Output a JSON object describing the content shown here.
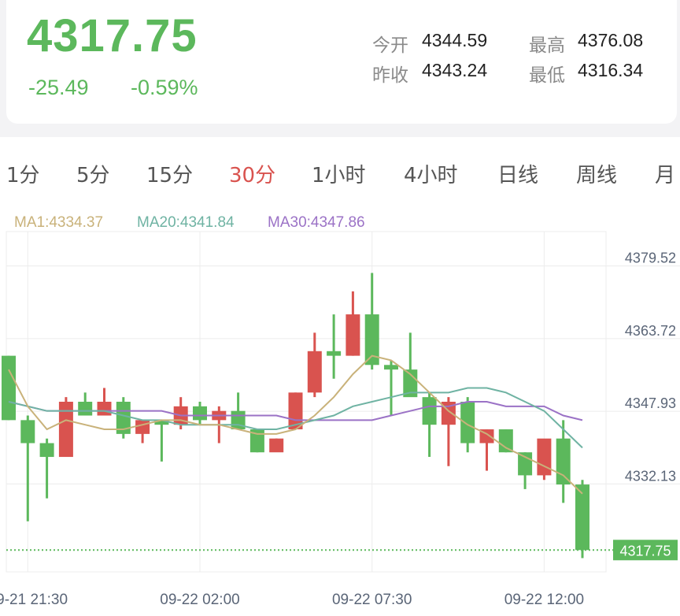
{
  "quote": {
    "price": "4317.75",
    "change_abs": "-25.49",
    "change_pct": "-0.59%",
    "stats": [
      {
        "label": "今开",
        "value": "4344.59"
      },
      {
        "label": "最高",
        "value": "4376.08"
      },
      {
        "label": "昨收",
        "value": "4343.24"
      },
      {
        "label": "最低",
        "value": "4316.34"
      }
    ]
  },
  "tabs": [
    {
      "label": "1分",
      "active": false
    },
    {
      "label": "5分",
      "active": false
    },
    {
      "label": "15分",
      "active": false
    },
    {
      "label": "30分",
      "active": true
    },
    {
      "label": "1小时",
      "active": false
    },
    {
      "label": "4小时",
      "active": false
    },
    {
      "label": "日线",
      "active": false
    },
    {
      "label": "周线",
      "active": false
    },
    {
      "label": "月",
      "active": false
    }
  ],
  "colors": {
    "up": "#d9534f",
    "down": "#5cb85c",
    "ma1": "#c9b27a",
    "ma20": "#6fb3a3",
    "ma30": "#9b72c6",
    "grid": "#ececec",
    "axis_text": "#5a6577"
  },
  "chart_data": {
    "type": "candlestick",
    "indicators": [
      {
        "name": "MA1",
        "label": "MA1:4334.37"
      },
      {
        "name": "MA20",
        "label": "MA20:4341.84"
      },
      {
        "name": "MA30",
        "label": "MA30:4347.86"
      }
    ],
    "y_ticks": [
      "4379.52",
      "4363.72",
      "4347.93",
      "4332.13"
    ],
    "ylim": [
      4313,
      4387
    ],
    "last_price_label": "4317.75",
    "last_price": 4317.75,
    "x_ticks": [
      {
        "label": "09-21 21:30",
        "index": 1
      },
      {
        "label": "09-22 02:00",
        "index": 10
      },
      {
        "label": "09-22 07:30",
        "index": 19
      },
      {
        "label": "09-22 12:00",
        "index": 28
      }
    ],
    "candles": [
      {
        "o": 4360,
        "h": 4360,
        "l": 4346,
        "c": 4346
      },
      {
        "o": 4346,
        "h": 4347,
        "l": 4324,
        "c": 4341
      },
      {
        "o": 4341,
        "h": 4342,
        "l": 4329,
        "c": 4338
      },
      {
        "o": 4338,
        "h": 4351,
        "l": 4338,
        "c": 4350
      },
      {
        "o": 4350,
        "h": 4352,
        "l": 4347,
        "c": 4347
      },
      {
        "o": 4347,
        "h": 4353,
        "l": 4347,
        "c": 4350
      },
      {
        "o": 4350,
        "h": 4351,
        "l": 4342,
        "c": 4343
      },
      {
        "o": 4343,
        "h": 4346,
        "l": 4341,
        "c": 4346
      },
      {
        "o": 4346,
        "h": 4346,
        "l": 4337,
        "c": 4345
      },
      {
        "o": 4345,
        "h": 4351,
        "l": 4344,
        "c": 4349
      },
      {
        "o": 4349,
        "h": 4350,
        "l": 4345,
        "c": 4346
      },
      {
        "o": 4346,
        "h": 4349,
        "l": 4341,
        "c": 4348
      },
      {
        "o": 4348,
        "h": 4352,
        "l": 4345,
        "c": 4344
      },
      {
        "o": 4344,
        "h": 4344,
        "l": 4339,
        "c": 4339
      },
      {
        "o": 4339,
        "h": 4342,
        "l": 4340,
        "c": 4342
      },
      {
        "o": 4344,
        "h": 4352,
        "l": 4344,
        "c": 4352
      },
      {
        "o": 4352,
        "h": 4365,
        "l": 4351,
        "c": 4361
      },
      {
        "o": 4361,
        "h": 4369,
        "l": 4355,
        "c": 4360
      },
      {
        "o": 4360,
        "h": 4374,
        "l": 4360,
        "c": 4369
      },
      {
        "o": 4369,
        "h": 4378,
        "l": 4357,
        "c": 4358
      },
      {
        "o": 4358,
        "h": 4359,
        "l": 4347,
        "c": 4357
      },
      {
        "o": 4357,
        "h": 4365,
        "l": 4354,
        "c": 4351
      },
      {
        "o": 4351,
        "h": 4352,
        "l": 4338,
        "c": 4345
      },
      {
        "o": 4345,
        "h": 4351,
        "l": 4336,
        "c": 4350
      },
      {
        "o": 4350,
        "h": 4351,
        "l": 4339,
        "c": 4341
      },
      {
        "o": 4341,
        "h": 4344,
        "l": 4335,
        "c": 4344
      },
      {
        "o": 4344,
        "h": 4344,
        "l": 4339,
        "c": 4339
      },
      {
        "o": 4339,
        "h": 4339,
        "l": 4331,
        "c": 4334
      },
      {
        "o": 4334,
        "h": 4341,
        "l": 4333,
        "c": 4342
      },
      {
        "o": 4342,
        "h": 4346,
        "l": 4328,
        "c": 4332
      },
      {
        "o": 4332,
        "h": 4333,
        "l": 4316,
        "c": 4317.75
      }
    ],
    "ma1": [
      4357,
      4349,
      4344,
      4346,
      4345,
      4344,
      4344,
      4345,
      4346,
      4346,
      4345,
      4345,
      4344,
      4343,
      4343,
      4344,
      4347,
      4351,
      4356,
      4360,
      4359,
      4356,
      4352,
      4348,
      4345,
      4343,
      4340,
      4338,
      4336,
      4334,
      4330
    ],
    "ma20": [
      4350,
      4349,
      4348,
      4348,
      4348,
      4348,
      4347,
      4346,
      4346,
      4345,
      4345,
      4345,
      4345,
      4344,
      4344,
      4345,
      4346,
      4347,
      4349,
      4350,
      4351,
      4352,
      4352,
      4352,
      4353,
      4353,
      4352,
      4350,
      4348,
      4344,
      4340
    ],
    "ma30": [
      4350,
      4349,
      4348,
      4348,
      4348,
      4348,
      4348,
      4348,
      4348,
      4347,
      4347,
      4347,
      4347,
      4347,
      4347,
      4346,
      4346,
      4346,
      4346,
      4346,
      4347,
      4348,
      4349,
      4349,
      4350,
      4350,
      4349,
      4349,
      4349,
      4347,
      4346
    ]
  }
}
